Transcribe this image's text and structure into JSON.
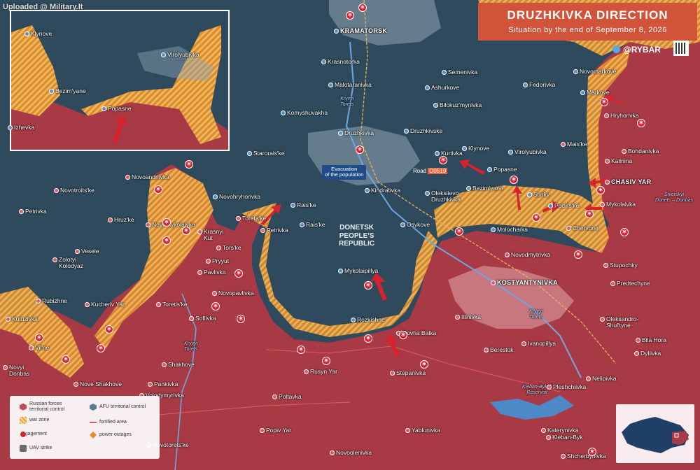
{
  "watermark": "Uploaded @ Military.lt",
  "title": "Druzhkivka direction",
  "subtitle": "Situation by the end of September 8, 2026",
  "brand": "@RYBAR",
  "region_label": "DONETSK\nPEOPLE'S\nREPUBLIC",
  "evacuation_label": "Evacuation\nof the population",
  "road": {
    "prefix": "Road",
    "code": "О0519"
  },
  "rivers": [
    "Kryvyi\nTorets",
    "Kryvyi\nTorets",
    "Kryvyi\nTorets",
    "Siverskyi\nDonets – Donbas"
  ],
  "reservoir": "Kleban-Byksk\nReservoir",
  "colors": {
    "russian_control": "#a83a45",
    "afu_control": "#2f4a5c",
    "war_zone": "#e7a23b",
    "engagement": "#d8232f",
    "brand": "#d1543a"
  },
  "towns_main": [
    {
      "name": "KRAMATORSK",
      "side": "ua",
      "big": true
    },
    {
      "name": "Krasnotorka",
      "side": "ua"
    },
    {
      "name": "Malotaranivka",
      "side": "ua"
    },
    {
      "name": "Semenivka",
      "side": "ua"
    },
    {
      "name": "Ashurkove",
      "side": "ua"
    },
    {
      "name": "Fedorivka",
      "side": "ua"
    },
    {
      "name": "Novomarkove",
      "side": "ua"
    },
    {
      "name": "Markove",
      "side": "ua"
    },
    {
      "name": "Bilokuz'mynivka",
      "side": "ua"
    },
    {
      "name": "Hryhorivka",
      "side": "ru"
    },
    {
      "name": "Komyshuvakha",
      "side": "ua"
    },
    {
      "name": "Druzhkivka",
      "side": "ua"
    },
    {
      "name": "Druzhkivske",
      "side": "ua"
    },
    {
      "name": "Mais'ke",
      "side": "ru"
    },
    {
      "name": "Bohdanivka",
      "side": "ru"
    },
    {
      "name": "Starorais'ke",
      "side": "ua"
    },
    {
      "name": "Kurtivka",
      "side": "ua"
    },
    {
      "name": "Klynove",
      "side": "ua"
    },
    {
      "name": "Virolyubivka",
      "side": "ua"
    },
    {
      "name": "Kalinina",
      "side": "ru"
    },
    {
      "name": "Novoandriivka",
      "side": "ru"
    },
    {
      "name": "Popasne",
      "side": "ua"
    },
    {
      "name": "Bezim'yane",
      "side": "ua"
    },
    {
      "name": "Stinky",
      "side": "ua"
    },
    {
      "name": "CHASIV YAR",
      "side": "ru",
      "big": true
    },
    {
      "name": "Novohryhorivka",
      "side": "ua"
    },
    {
      "name": "Kindrativka",
      "side": "ua"
    },
    {
      "name": "Oleksiievo-\nDruzhkivka",
      "side": "ua"
    },
    {
      "name": "Podil's'ke",
      "side": "ua"
    },
    {
      "name": "Mykolaivka",
      "side": "ru"
    },
    {
      "name": "Novotroits'ke",
      "side": "ru"
    },
    {
      "name": "Petrivka",
      "side": "ru"
    },
    {
      "name": "Rais'ke",
      "side": "ua"
    },
    {
      "name": "Toreta'ke",
      "side": "ru"
    },
    {
      "name": "Petrivka",
      "side": "ru"
    },
    {
      "name": "Rais'ke",
      "side": "ua"
    },
    {
      "name": "Osykove",
      "side": "ua"
    },
    {
      "name": "Molocharka",
      "side": "ua"
    },
    {
      "name": "Chervone",
      "side": "ru"
    },
    {
      "name": "Novomykolaivka",
      "side": "ru"
    },
    {
      "name": "Krasnyi\nKut",
      "side": "ru"
    },
    {
      "name": "Hruz'ke",
      "side": "ru"
    },
    {
      "name": "Tors'ke",
      "side": "ru"
    },
    {
      "name": "Novodmytrivka",
      "side": "ru"
    },
    {
      "name": "Vesele",
      "side": "ru"
    },
    {
      "name": "Zolotyi\nKolodyaz",
      "side": "ru"
    },
    {
      "name": "Pryyut",
      "side": "ru"
    },
    {
      "name": "Stupochky",
      "side": "ru"
    },
    {
      "name": "Mykolaipillya",
      "side": "ua"
    },
    {
      "name": "Pavlivka",
      "side": "ru"
    },
    {
      "name": "KOSTYANTYNIVKA",
      "side": "ru",
      "big": true
    },
    {
      "name": "Predtechyne",
      "side": "ru"
    },
    {
      "name": "Novopavlivka",
      "side": "ru"
    },
    {
      "name": "Rubizhne",
      "side": "ru"
    },
    {
      "name": "Kucheriv Yar",
      "side": "ru"
    },
    {
      "name": "Toretis'ke",
      "side": "ru"
    },
    {
      "name": "Illinivka",
      "side": "ru"
    },
    {
      "name": "Sofiivka",
      "side": "ru"
    },
    {
      "name": "Rozkishne",
      "side": "ua"
    },
    {
      "name": "Kutuzivka",
      "side": "ru"
    },
    {
      "name": "Oleksandro-\nShul'tyne",
      "side": "ru"
    },
    {
      "name": "Dovha Balka",
      "side": "ru"
    },
    {
      "name": "Bila Hora",
      "side": "ru"
    },
    {
      "name": "Vil'ne",
      "side": "ru"
    },
    {
      "name": "Berestok",
      "side": "ru"
    },
    {
      "name": "Ivanopillya",
      "side": "ru"
    },
    {
      "name": "Dyliivka",
      "side": "ru"
    },
    {
      "name": "Novyi\nDonbas",
      "side": "ru"
    },
    {
      "name": "Shakhove",
      "side": "ru"
    },
    {
      "name": "Rusyn Yar",
      "side": "ru"
    },
    {
      "name": "Stepanivka",
      "side": "ru"
    },
    {
      "name": "Nove Shakhove",
      "side": "ru"
    },
    {
      "name": "Pankivka",
      "side": "ru"
    },
    {
      "name": "Nelipivka",
      "side": "ru"
    },
    {
      "name": "Volodymyrivka",
      "side": "ru"
    },
    {
      "name": "Pleshchiivka",
      "side": "ru"
    },
    {
      "name": "Poltavka",
      "side": "ru"
    },
    {
      "name": "Popiv Yar",
      "side": "ru"
    },
    {
      "name": "Yablunivka",
      "side": "ru"
    },
    {
      "name": "Kleban-Byk",
      "side": "ru"
    },
    {
      "name": "Katerynivka",
      "side": "ru"
    },
    {
      "name": "Novotorets'ke",
      "side": "ru"
    },
    {
      "name": "Novoolenivka",
      "side": "ru"
    },
    {
      "name": "Shcherbynivka",
      "side": "ru"
    }
  ],
  "towns_inset": [
    {
      "name": "Klynove"
    },
    {
      "name": "Virolyubivka"
    },
    {
      "name": "Bezim'yane"
    },
    {
      "name": "Popasne"
    },
    {
      "name": "Izhevka"
    }
  ],
  "legend": {
    "russian": "Russian forces\nterritorial control",
    "afu": "AFU territorial control",
    "war_zone": "war zone",
    "fortified": "fortified area",
    "engagement": "engagement",
    "power": "power outages",
    "uav": "UAV strike"
  }
}
